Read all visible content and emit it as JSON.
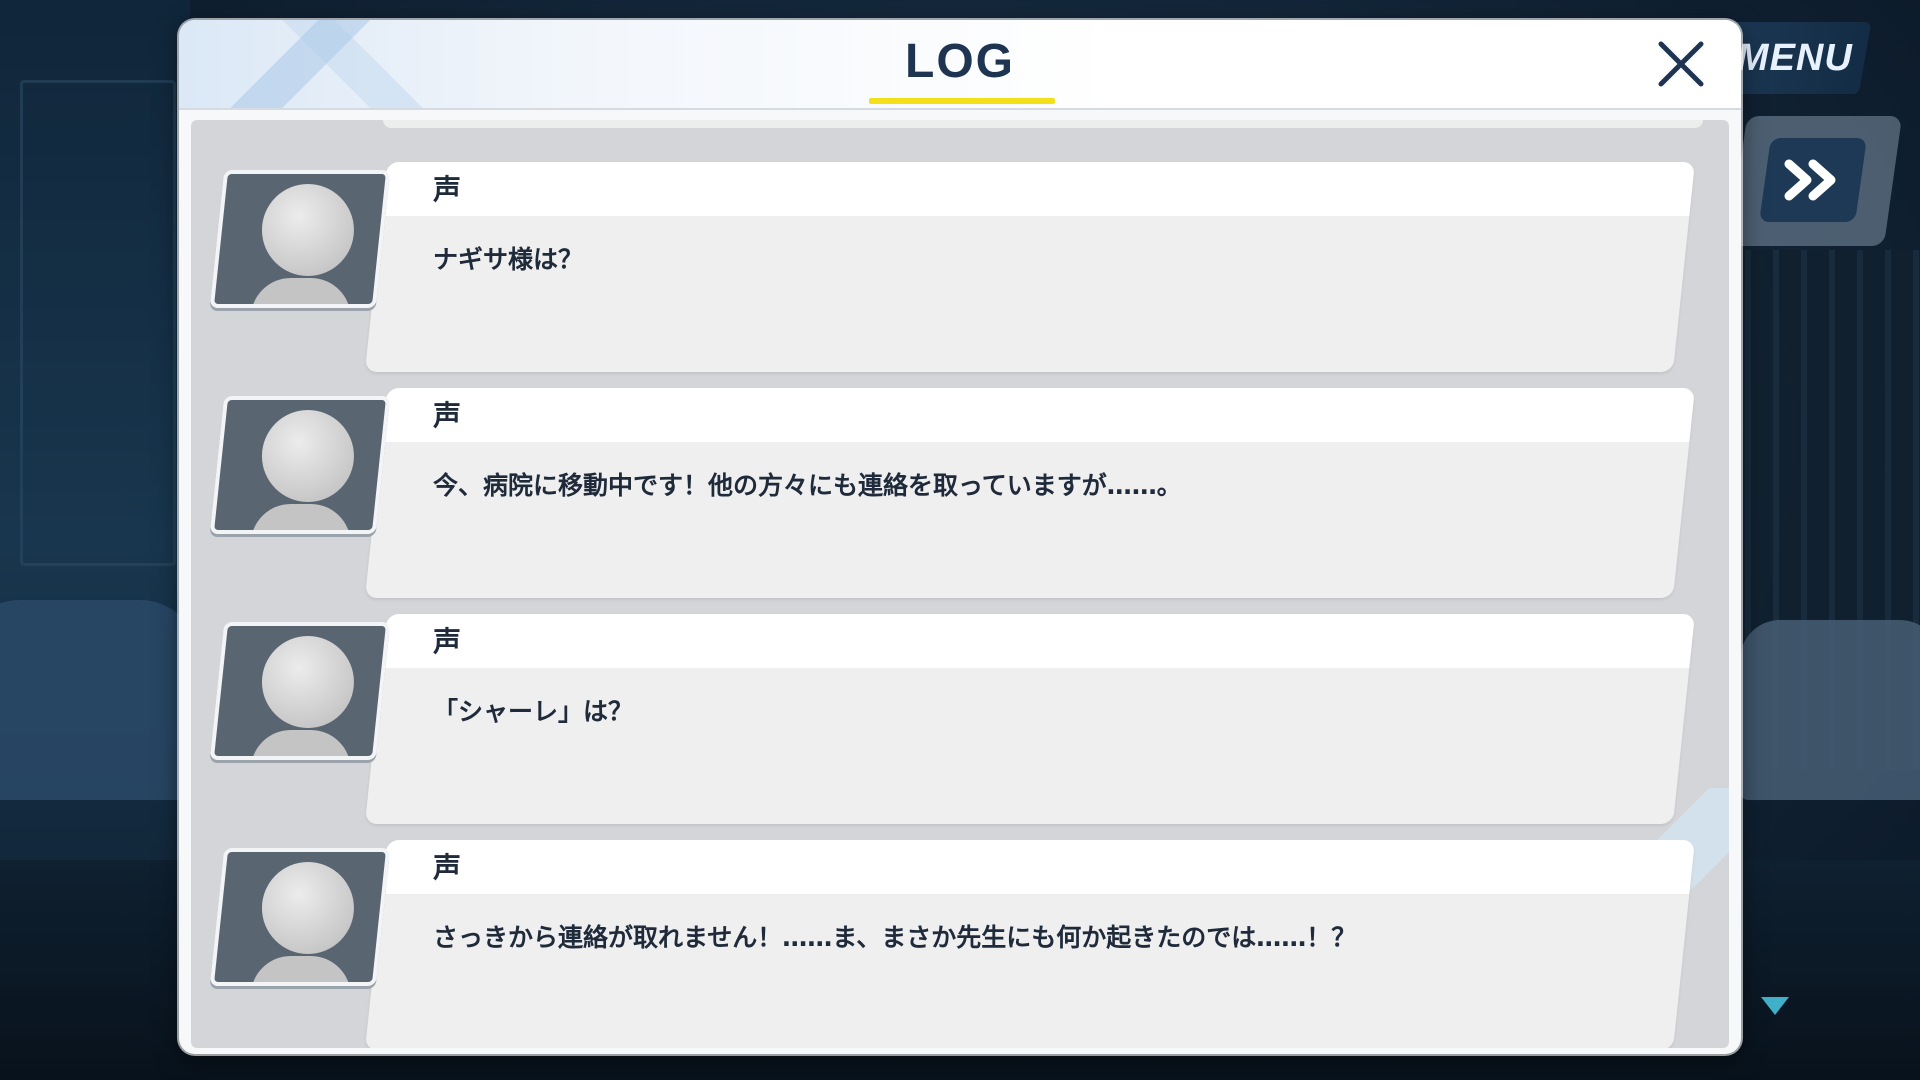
{
  "dialog": {
    "title": "LOG",
    "close_icon": "close-icon"
  },
  "hud": {
    "menu_label": "MENU",
    "skip_icon": "fast-forward-icon",
    "scroll_icon": "triangle-down-icon"
  },
  "entries": [
    {
      "speaker": "声",
      "text": "ナギサ様は？",
      "avatar_icon": "silhouette-avatar-icon"
    },
    {
      "speaker": "声",
      "text": "今、病院に移動中です！他の方々にも連絡を取っていますが……。",
      "avatar_icon": "silhouette-avatar-icon"
    },
    {
      "speaker": "声",
      "text": "「シャーレ」は？",
      "avatar_icon": "silhouette-avatar-icon"
    },
    {
      "speaker": "声",
      "text": "さっきから連絡が取れません！……ま、まさか先生にも何か起きたのでは……！？",
      "avatar_icon": "silhouette-avatar-icon"
    }
  ],
  "colors": {
    "title": "#1e3450",
    "title_underline": "#f4e01a",
    "skip_button": "#1d3956",
    "scroll_arrow": "#3fb0c8"
  }
}
